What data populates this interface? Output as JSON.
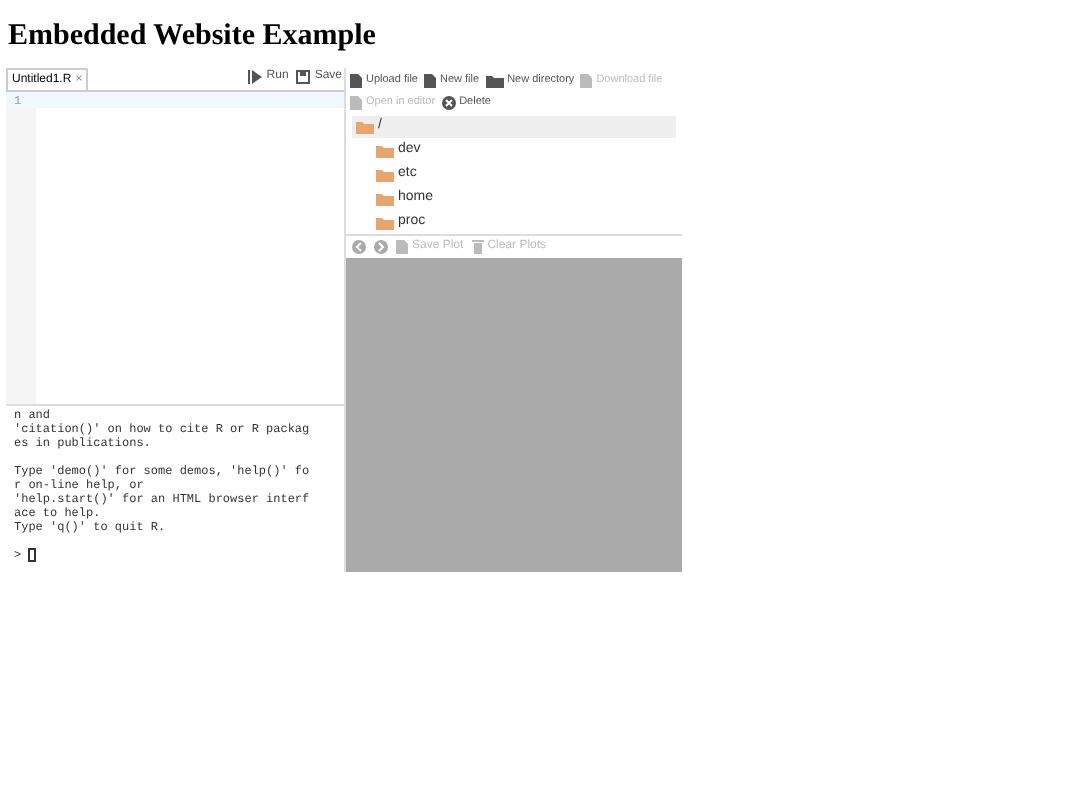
{
  "heading": "Embedded Website Example",
  "editor": {
    "tab": {
      "label": "Untitled1.R",
      "close": "×",
      "selected": true
    },
    "actions": [
      {
        "kind": "run",
        "label": "Run"
      },
      {
        "kind": "save",
        "label": "Save"
      }
    ],
    "line_numbers": [
      "1"
    ]
  },
  "console": {
    "paragraphs": [
      [
        "n and",
        "'citation()' on how to cite R or R packag",
        "es in publications."
      ],
      [
        "Type 'demo()' for some demos, 'help()' fo",
        "r on-line help, or",
        "'help.start()' for an HTML browser interf",
        "ace to help.",
        "Type 'q()' to quit R."
      ]
    ],
    "prompt": ">"
  },
  "files": {
    "toolbar": [
      {
        "kind": "file",
        "label": "Upload file",
        "disabled": false
      },
      {
        "kind": "file",
        "label": "New file",
        "disabled": false
      },
      {
        "kind": "folder",
        "label": "New directory",
        "disabled": false
      },
      {
        "kind": "file",
        "label": "Download file",
        "disabled": true
      },
      {
        "kind": "file",
        "label": "Open in editor",
        "disabled": true
      },
      {
        "kind": "delete",
        "label": "Delete",
        "disabled": false
      }
    ],
    "items": [
      {
        "name": "/",
        "selected": true,
        "children": [
          {
            "name": "dev",
            "selected": false
          },
          {
            "name": "etc",
            "selected": false
          },
          {
            "name": "home",
            "selected": false
          },
          {
            "name": "proc",
            "selected": false
          }
        ]
      }
    ]
  },
  "plots": {
    "toolbar": [
      {
        "kind": "prev",
        "disabled": true
      },
      {
        "kind": "next",
        "disabled": true
      },
      {
        "kind": "file",
        "label": "Save Plot",
        "disabled": true
      },
      {
        "kind": "trash",
        "label": "Clear Plots",
        "disabled": true
      }
    ]
  }
}
